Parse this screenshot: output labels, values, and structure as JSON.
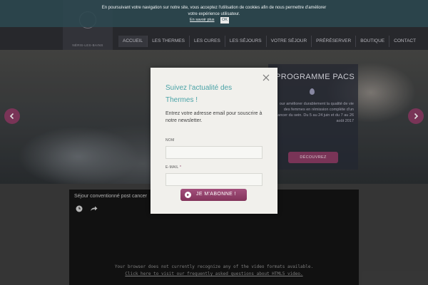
{
  "cookie_bar": {
    "text": "En poursuivant votre navigation sur notre site, vous acceptez l'utilisation de cookies afin de nous permettre d'améliorer votre expérience utilisateur.",
    "more_link": "En savoir plus",
    "ok_label": "OK"
  },
  "header": {
    "logo_sub": "NÉRIS-LES-BAINS",
    "nav": [
      "ACCUEIL",
      "LES THERMES",
      "LES CURES",
      "LES SÉJOURS",
      "VOTRE SÉJOUR",
      "PRÉRÉSERVER",
      "BOUTIQUE",
      "CONTACT"
    ]
  },
  "hero": {
    "panel_title": "PROGRAMME PACS",
    "panel_text": "our améliorer durablement la qualité de vie des femmes en rémission complète d'un cancer du sein. Du 5 au 24 juin et du 7 au 26 août 2017",
    "discover_label": "DÉCOUVREZ"
  },
  "video": {
    "title": "Séjour conventionné post cancer",
    "msg_line1": "Your browser does not currently recognize any of the video formats available.",
    "msg_line2": "Click here to visit our frequently asked questions about HTML5 video."
  },
  "newsletter": {
    "title": "Suivez l'actualité des Thermes !",
    "intro": "Entrez votre adresse email pour souscrire à notre newsletter.",
    "name_label": "NOM",
    "email_label": "E-MAIL",
    "required_mark": "*",
    "name_value": "",
    "email_value": "",
    "subscribe_label": "JE M'ABONNE !"
  },
  "colors": {
    "accent": "#8a3c63",
    "title": "#4aa3a7",
    "cookie_bg": "#2c4850"
  }
}
